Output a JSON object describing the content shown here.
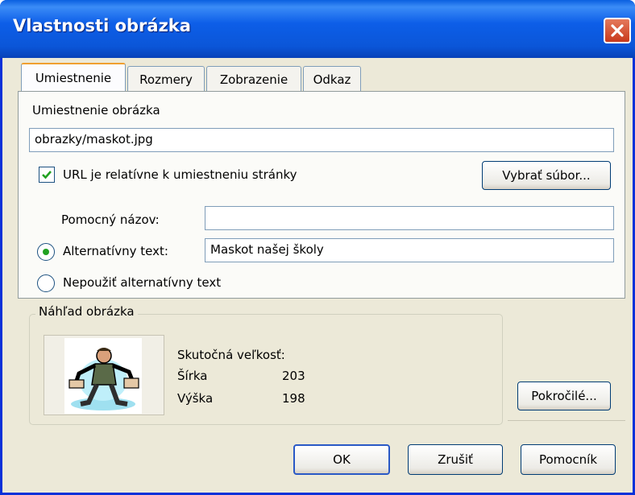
{
  "window": {
    "title": "Vlastnosti obrázka"
  },
  "tabs": [
    {
      "label": "Umiestnenie"
    },
    {
      "label": "Rozmery"
    },
    {
      "label": "Zobrazenie"
    },
    {
      "label": "Odkaz"
    }
  ],
  "location": {
    "section_label": "Umiestnenie obrázka",
    "path_value": "obrazky/maskot.jpg",
    "relative_checkbox_label": "URL je relatívne k umiestneniu stránky",
    "relative_checked": true,
    "choose_file_button": "Vybrať súbor...",
    "tooltip_label": "Pomocný názov:",
    "tooltip_value": "",
    "alt_text_label": "Alternatívny text:",
    "alt_text_value": "Maskot našej školy",
    "alt_selected": true,
    "no_alt_label": "Nepoužiť alternatívny text"
  },
  "preview": {
    "group_label": "Náhľad obrázka",
    "actual_size_label": "Skutočná veľkosť:",
    "width_label": "Šírka",
    "width_value": "203",
    "height_label": "Výška",
    "height_value": "198"
  },
  "buttons": {
    "advanced": "Pokročilé...",
    "ok": "OK",
    "cancel": "Zrušiť",
    "help": "Pomocník"
  },
  "colors": {
    "titlebar": "#0b56d8",
    "dialog_bg": "#ece9d8",
    "close": "#c8391c",
    "check_green": "#21a121"
  }
}
